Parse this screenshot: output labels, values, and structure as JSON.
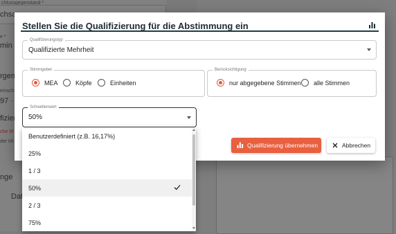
{
  "background": {
    "label_top": "chlussgegenstand *",
    "field_top_value": "chsa",
    "label_2": "e *",
    "field_2_value": "min",
    "label_3": "rgem",
    "label_4": "einsch",
    "value_4": "97 · S",
    "label_5": "fizier",
    "red_text": "che M",
    "text_6": "der MI",
    "text_7": "nge",
    "text_8": "Date"
  },
  "dialog": {
    "title": "Stellen Sie die Qualifizierung für die Abstimmung ein",
    "qualifizierungstyp": {
      "label": "Qualifizierungstyp",
      "value": "Qualifizierte Mehrheit"
    },
    "stimmgeber": {
      "label": "Stimmgeber",
      "options": [
        "MEA",
        "Köpfe",
        "Einheiten"
      ],
      "selected": "MEA"
    },
    "beruecksichtigung": {
      "label": "Berücksichtigung",
      "options": [
        "nur abgegebene Stimmen",
        "alle Stimmen"
      ],
      "selected": "nur abgegebene Stimmen"
    },
    "schwellenwert": {
      "label": "Schwellenwert",
      "value": "50%",
      "options": [
        "Benutzerdefiniert (z.B. 16,17%)",
        "25%",
        "1 / 3",
        "50%",
        "2 / 3",
        "75%"
      ],
      "selected_index": 3
    },
    "buttons": {
      "apply": "Qualifizierung übernehmen",
      "cancel": "Abbrechen"
    },
    "colors": {
      "accent": "#e8603f",
      "title_rule": "#1f3b42"
    },
    "icons": {
      "header": "bar-chart-icon",
      "apply": "bar-chart-icon",
      "cancel": "close-icon",
      "selected_option": "check-icon"
    }
  }
}
